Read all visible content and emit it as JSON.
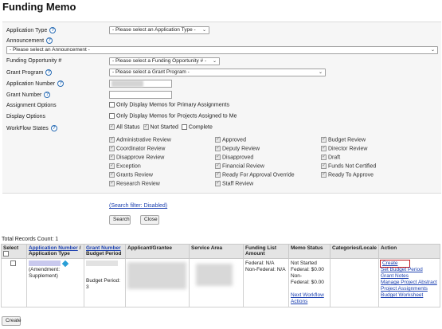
{
  "page": {
    "title": "Funding Memo"
  },
  "form": {
    "application_type": {
      "label": "Application Type",
      "value": "- Please select an Application Type -"
    },
    "announcement": {
      "label": "Announcement",
      "value": "- Please select an Announcement -"
    },
    "funding_opportunity": {
      "label": "Funding Opportunity #",
      "value": "- Please select a Funding Opportunity # -"
    },
    "grant_program": {
      "label": "Grant Program",
      "value": "- Please select a Grant Program -"
    },
    "application_number": {
      "label": "Application Number"
    },
    "grant_number": {
      "label": "Grant Number"
    },
    "assignment_options": {
      "label": "Assignment Options",
      "checkbox": "Only Display Memos for Primary Assignments"
    },
    "display_options": {
      "label": "Display Options",
      "checkbox": "Only Display Memos for Projects Assigned to Me"
    },
    "workflow_states": {
      "label": "WorkFlow States",
      "top": [
        "All Status",
        "Not Started",
        "Complete"
      ],
      "col1": [
        "Administrative Review",
        "Coordinator Review",
        "Disapprove Review",
        "Exception",
        "Grants Review",
        "Research Review"
      ],
      "col2": [
        "Approved",
        "Deputy Review",
        "Disapproved",
        "Financial Review",
        "Ready For Approval Override",
        "Staff Review"
      ],
      "col3": [
        "Budget Review",
        "Director Review",
        "Draft",
        "Funds Not Certified",
        "Ready To Approve"
      ]
    },
    "search_filter": "(Search filter: Disabled)",
    "search_button": "Search",
    "close_button": "Close"
  },
  "results": {
    "total": "Total Records Count: 1",
    "headers": {
      "select": "Select",
      "app_number": "Application Number",
      "app_type": "Application Type",
      "grant_number": "Grant Number",
      "budget_period": "Budget Period",
      "applicant": "Applicant/Grantee",
      "service_area": "Service Area",
      "funding": "Funding List Amount",
      "memo_status": "Memo Status",
      "categories": "Categories/Locale",
      "action": "Action"
    },
    "row": {
      "app_type": "(Amendment: Supplement)",
      "budget_period": "Budget Period: 3",
      "funding_federal": "Federal:  N/A",
      "funding_nonfederal": "Non-Federal:  N/A",
      "memo_status": "Not Started",
      "memo_federal": "Federal: $0.00",
      "memo_nonfederal_1": "Non-",
      "memo_nonfederal_2": "Federal: $0.00",
      "next_workflow": "Next Workflow Actions",
      "actions": [
        "Create",
        "Set Budget Period",
        "Grant Notes",
        "Manage Project Abstract",
        "Project Assignments",
        "Budget Worksheet"
      ]
    }
  },
  "footer": {
    "create_button": "Create"
  }
}
